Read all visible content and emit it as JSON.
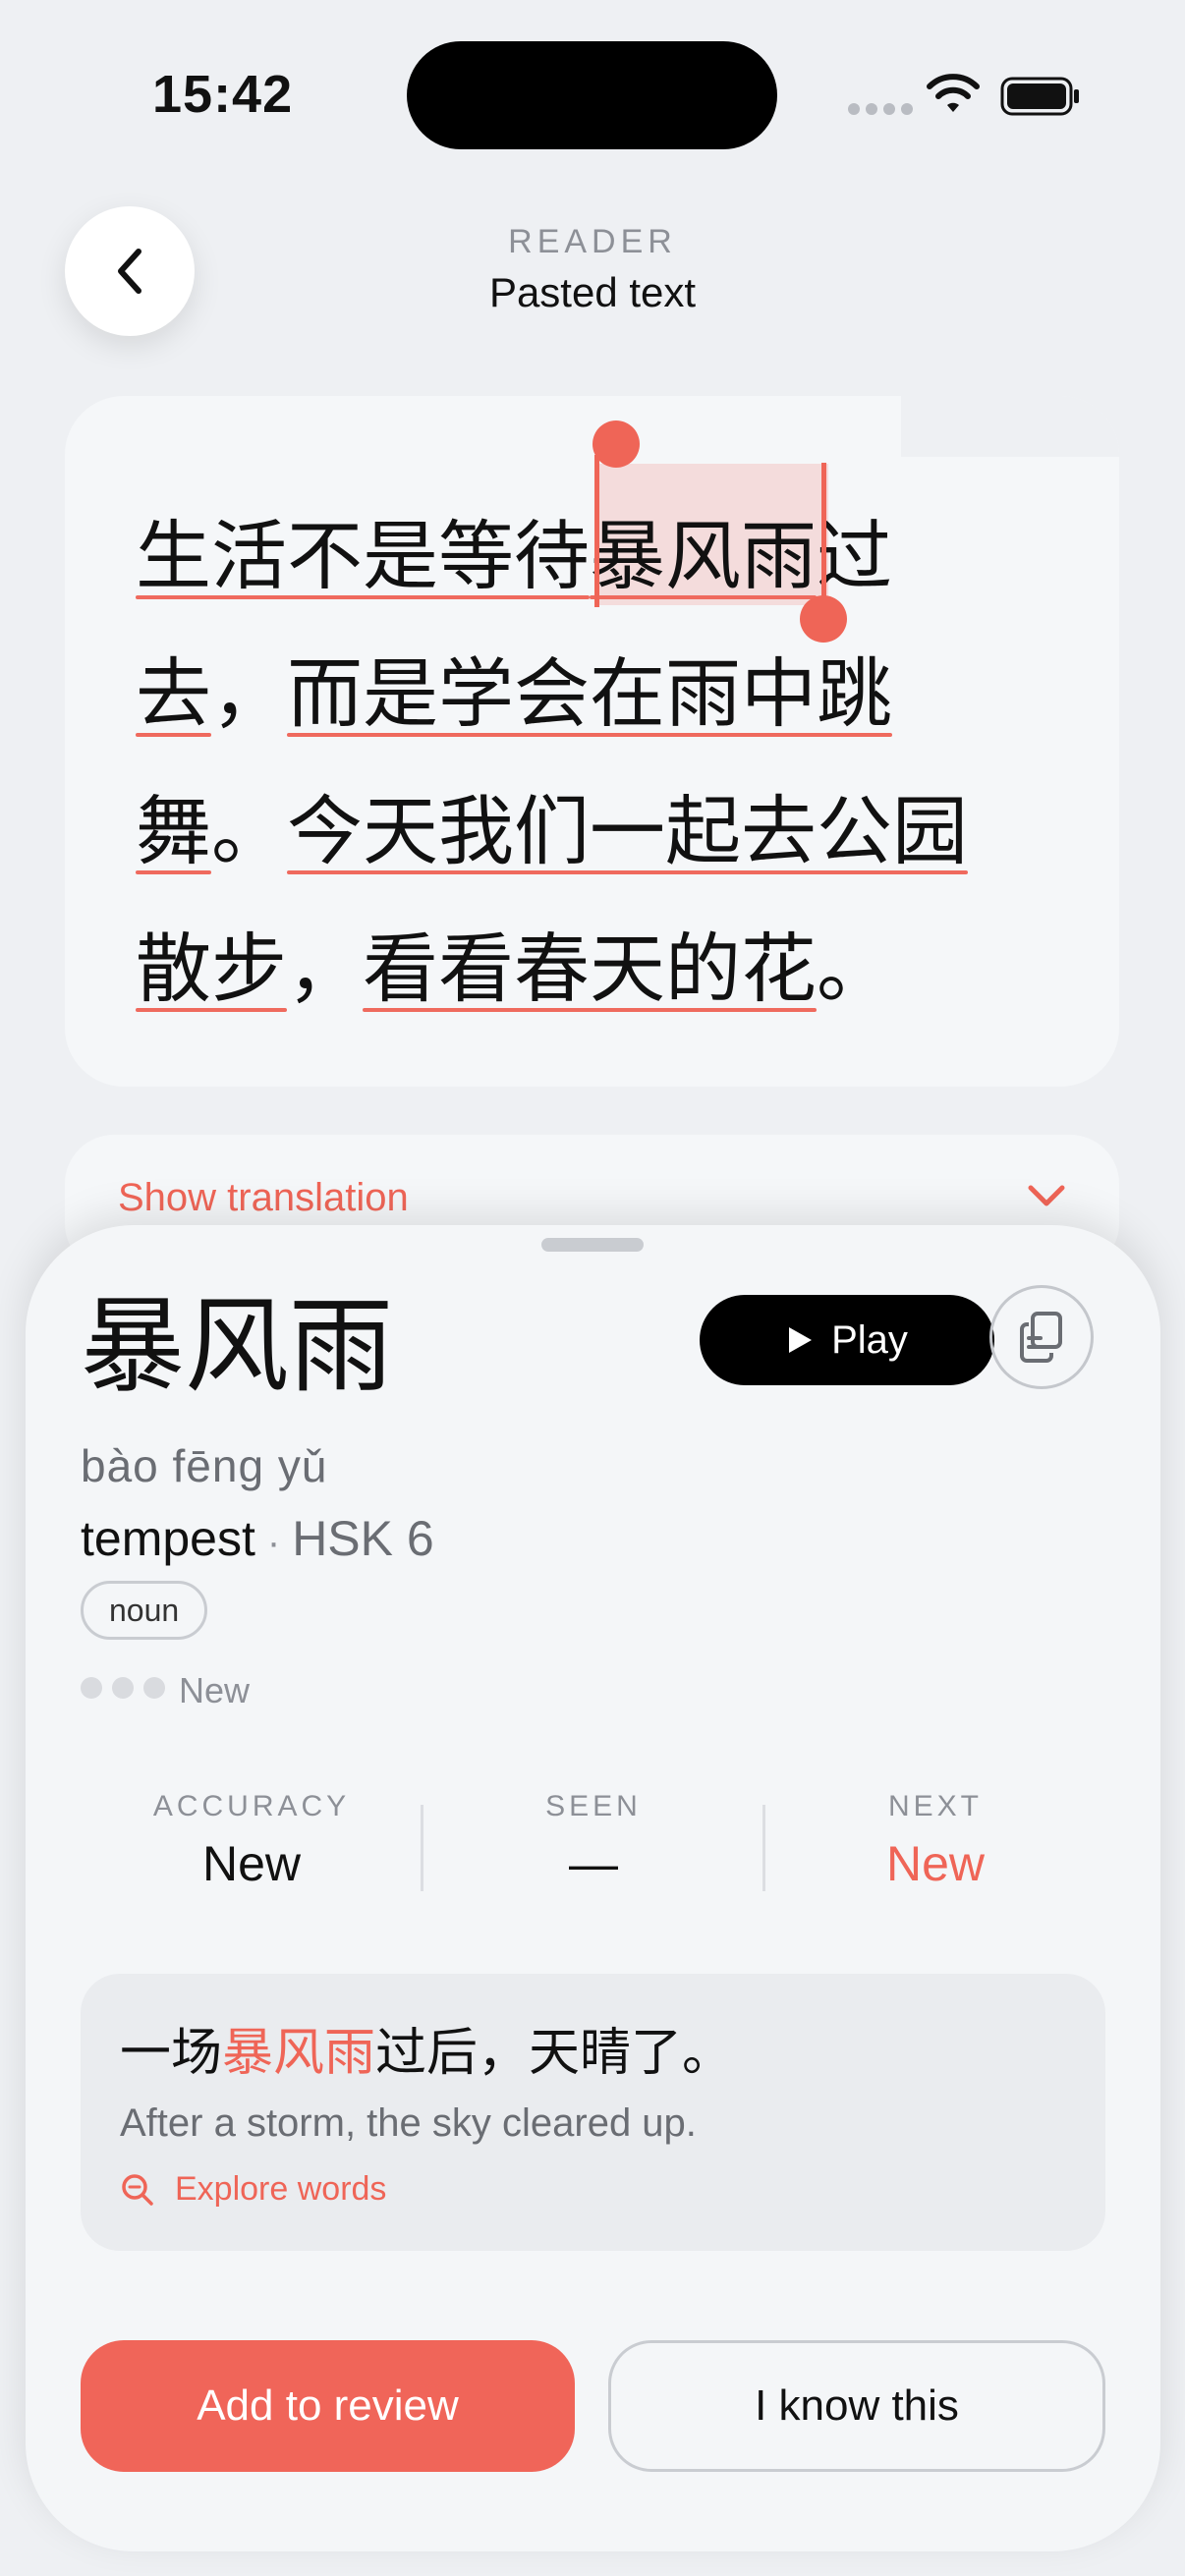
{
  "status_bar": {
    "time": "15:42"
  },
  "header": {
    "eyebrow": "READER",
    "title": "Pasted text"
  },
  "reader": {
    "lines": [
      [
        {
          "text": "生活不是等待",
          "u": true
        },
        {
          "text": "暴风雨",
          "u": true
        },
        {
          "text": "过",
          "u": false
        }
      ],
      [
        {
          "text": "去",
          "u": true
        },
        {
          "text": "，",
          "u": false
        },
        {
          "text": "而是学会在雨中跳",
          "u": true
        }
      ],
      [
        {
          "text": "舞",
          "u": true
        },
        {
          "text": "。",
          "u": false
        },
        {
          "text": "今天我们一起去公园",
          "u": true
        }
      ],
      [
        {
          "text": "散步",
          "u": true
        },
        {
          "text": "，",
          "u": false
        },
        {
          "text": "看看春天的花",
          "u": true
        },
        {
          "text": "。",
          "u": false
        }
      ]
    ],
    "selected_word": "暴风雨"
  },
  "translation": {
    "label": "Show translation"
  },
  "word": {
    "hanzi": "暴风雨",
    "play_label": "Play",
    "pinyin": "bào fēng yǔ",
    "meaning": "tempest",
    "separator": "·",
    "hsk": "HSK 6",
    "part_of_speech": "noun",
    "status": "New",
    "mastery_dots_filled": 0
  },
  "stats": {
    "accuracy_label": "ACCURACY",
    "accuracy_value": "New",
    "seen_label": "SEEN",
    "seen_value": "—",
    "next_label": "NEXT",
    "next_value": "New"
  },
  "example": {
    "zh_before": "一场",
    "zh_highlight": "暴风雨",
    "zh_after": "过后，天晴了。",
    "en": "After a storm, the sky cleared up.",
    "explore_label": "Explore words"
  },
  "actions": {
    "add_review": "Add to review",
    "know": "I know this"
  },
  "colors": {
    "accent": "#ef6557",
    "background": "#eef0f3",
    "card": "#f5f7f9"
  }
}
